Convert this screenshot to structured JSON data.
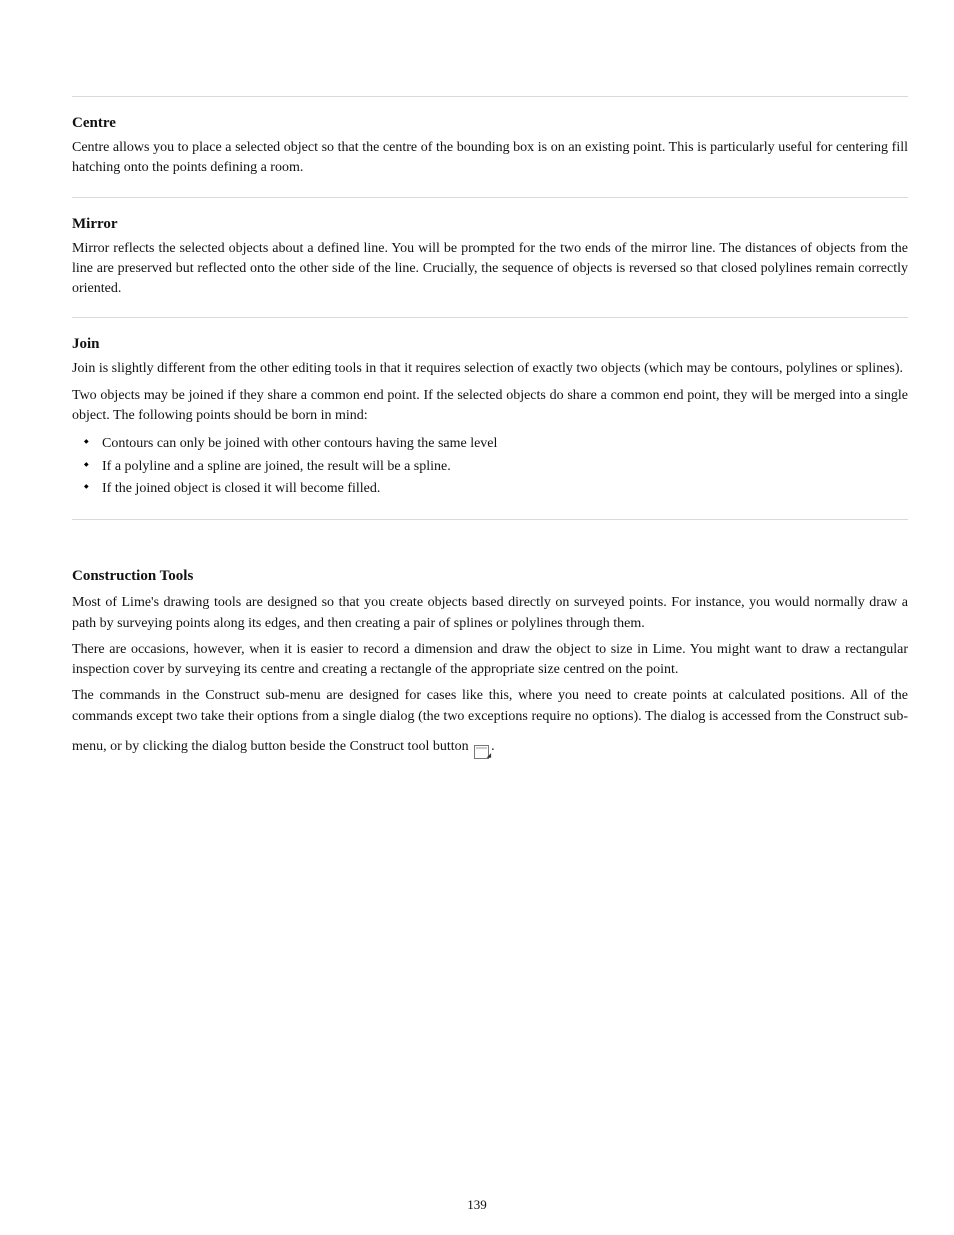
{
  "sections": {
    "center": {
      "title": "Centre",
      "body": "Centre allows you to place a selected object so that the centre of the bounding box is on an existing point. This is particularly useful for centering fill hatching onto the points defining a room."
    },
    "mirror": {
      "title": "Mirror",
      "body": "Mirror reflects the selected objects about a defined line. You will be prompted for the two ends of the mirror line. The distances of objects from the line are preserved but reflected onto the other side of the line. Crucially, the sequence of objects is reversed so that closed polylines remain correctly oriented."
    },
    "join": {
      "title": "Join",
      "body1": "Join is slightly different from the other editing tools in that it requires selection of exactly two objects (which may be contours, polylines or splines).",
      "body2": "Two objects may be joined if they share a common end point. If the selected objects do share a common end point, they will be merged into a single object. The following points should be born in mind:",
      "bullets": [
        "Contours can only be joined with other contours having the same level",
        "If a polyline and a spline are joined, the result will be a spline.",
        "If the joined object is closed it will become filled."
      ]
    },
    "construction": {
      "title": "Construction Tools",
      "body1": "Most of Lime's drawing tools are designed so that you create objects based directly on surveyed points. For instance, you would normally draw a path by surveying points along its edges, and then creating a pair of splines or polylines through them.",
      "body2": "There are occasions, however, when it is easier to record a dimension and draw the object to size in Lime. You might want to draw a rectangular inspection cover by surveying its centre and creating a rectangle of the appropriate size centred on the point.",
      "body3": "The commands in the Construct sub-menu are designed for cases like this, where you need to create points at calculated positions. All of the commands except two take their options from a single dialog (the two exceptions require no options). The dialog is accessed from the Construct sub-menu, or by clicking the dialog button beside the Construct tool button",
      "body3_tail": "."
    }
  },
  "pageNumber": "139"
}
